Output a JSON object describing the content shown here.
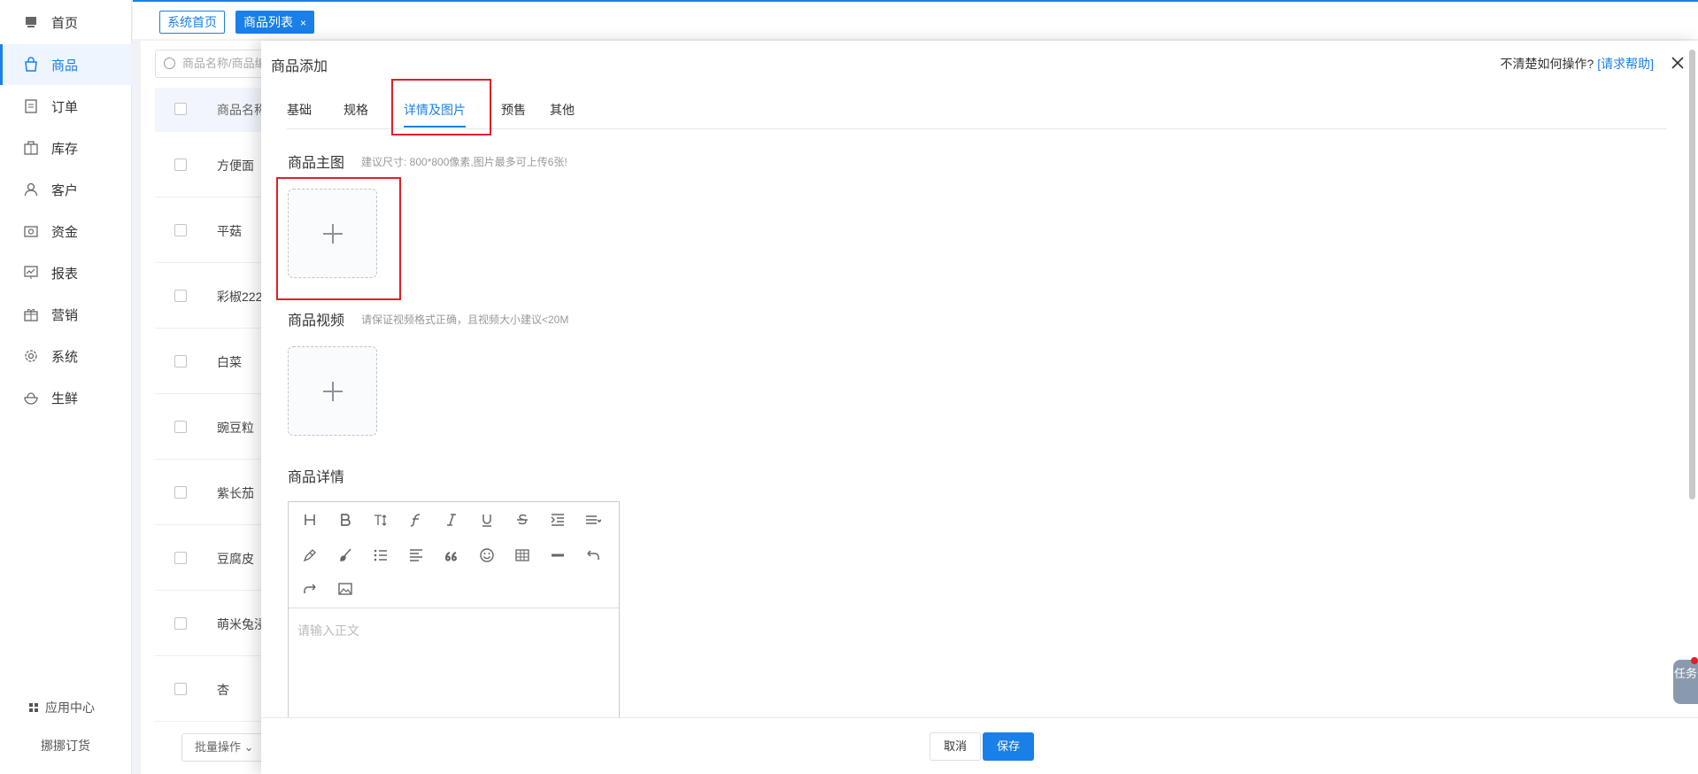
{
  "sidebar": {
    "items": [
      {
        "label": "首页",
        "icon": "home-icon"
      },
      {
        "label": "商品",
        "icon": "shopping-bag-icon"
      },
      {
        "label": "订单",
        "icon": "order-document-icon"
      },
      {
        "label": "库存",
        "icon": "warehouse-icon"
      },
      {
        "label": "客户",
        "icon": "user-icon"
      },
      {
        "label": "资金",
        "icon": "wallet-icon"
      },
      {
        "label": "报表",
        "icon": "chart-board-icon"
      },
      {
        "label": "营销",
        "icon": "gift-icon"
      },
      {
        "label": "系统",
        "icon": "gear-icon"
      },
      {
        "label": "生鲜",
        "icon": "fresh-bowl-icon"
      }
    ],
    "active_index": 1,
    "app_center": "应用中心",
    "brand": "挪挪订货"
  },
  "tabs_bar": {
    "home": "系统首页",
    "current": "商品列表",
    "close": "×"
  },
  "list": {
    "search_placeholder": "商品名称/商品编",
    "header_col": "商品名称",
    "rows": [
      "方便面",
      "平菇",
      "彩椒222",
      "白菜",
      "豌豆粒",
      "紫长茄",
      "豆腐皮",
      "萌米兔浸",
      "杏"
    ],
    "batch_label": "批量操作"
  },
  "drawer": {
    "title": "商品添加",
    "help_text": "不清楚如何操作?",
    "help_link": "[请求帮助]",
    "tabs": [
      "基础",
      "规格",
      "详情及图片",
      "预售",
      "其他"
    ],
    "active_tab": 2,
    "main_image": {
      "title": "商品主图",
      "hint": "建议尺寸: 800*800像素,图片最多可上传6张!"
    },
    "video": {
      "title": "商品视频",
      "hint": "请保证视频格式正确，且视频大小建议<20M"
    },
    "detail": {
      "title": "商品详情",
      "placeholder": "请输入正文"
    },
    "cancel": "取消",
    "save": "保存"
  },
  "task_button": "任务",
  "colors": {
    "accent": "#1a7fe8",
    "highlight": "#e0202a"
  }
}
